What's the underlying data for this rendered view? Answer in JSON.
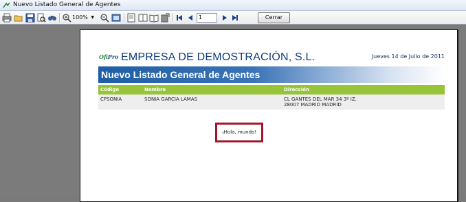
{
  "window": {
    "title": "Nuevo Listado General de Agentes"
  },
  "toolbar": {
    "icons": [
      "print-icon",
      "open-icon",
      "save-icon",
      "print-preview-icon",
      "find-icon",
      "zoom-in-icon",
      "zoom-out-icon",
      "single-page-icon",
      "fit-width-icon",
      "multi-page-icon",
      "export-icon",
      "first-page-icon",
      "prev-page-icon",
      "next-page-icon",
      "last-page-icon"
    ],
    "zoom": "100%",
    "page": "1",
    "close_label": "Cerrar"
  },
  "report": {
    "logo": {
      "part1": "Ofi",
      "part2": "Pro"
    },
    "company": "EMPRESA DE DEMOSTRACIÓN, S.L.",
    "date": "Jueves 14 de Julio de 2011",
    "title": "Nuevo Listado General de Agentes",
    "columns": {
      "code": "Código",
      "name": "Nombre",
      "address": "Dirección"
    },
    "rows": [
      {
        "code": "CPSONIA",
        "name": "SONIA GARCIA LAMAS",
        "address_line1": "CL GANTES DEL MAR 34 3º IZ.",
        "address_line2": "28007 MADRID MADRID"
      }
    ],
    "hello": "¡Hola, mundo!"
  },
  "colors": {
    "accent_green": "#98c43a",
    "banner_blue": "#1f5ea5",
    "highlight_red": "#a3162a"
  }
}
